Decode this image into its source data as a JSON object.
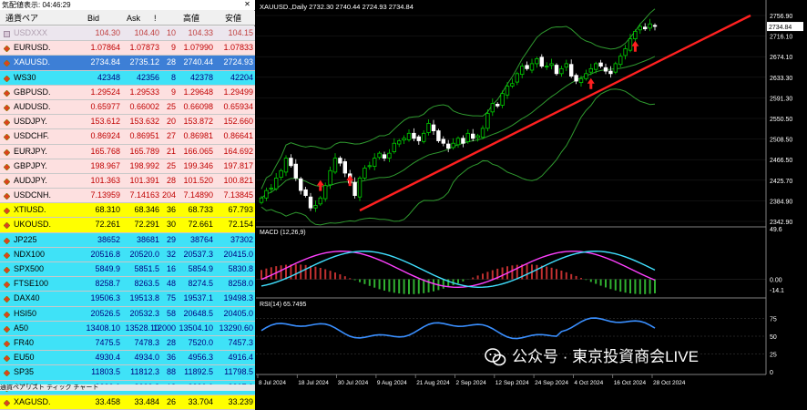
{
  "market_watch": {
    "title": "気配値表示: 04:46:29",
    "headers": {
      "symbol": "通貨ペア",
      "bid": "Bid",
      "ask": "Ask",
      "spread": "!",
      "high": "高値",
      "low": "安値"
    },
    "rows": [
      {
        "symbol": "USDXXX",
        "bid": "104.30",
        "ask": "104.40",
        "spread": "10",
        "high": "104.33",
        "low": "104.15",
        "bg": "#ece6ee",
        "fg": "#c04040",
        "disabled": true
      },
      {
        "symbol": "EURUSD.",
        "bid": "1.07864",
        "ask": "1.07873",
        "spread": "9",
        "high": "1.07990",
        "low": "1.07833",
        "bg": "#fde0e0",
        "fg": "#c00000"
      },
      {
        "symbol": "XAUUSD.",
        "bid": "2734.84",
        "ask": "2735.12",
        "spread": "28",
        "high": "2740.44",
        "low": "2724.93",
        "bg": "#3d7fd6",
        "fg": "#ffffff"
      },
      {
        "symbol": "WS30",
        "bid": "42348",
        "ask": "42356",
        "spread": "8",
        "high": "42378",
        "low": "42204",
        "bg": "#3fe2f7",
        "fg": "#000080"
      },
      {
        "symbol": "GBPUSD.",
        "bid": "1.29524",
        "ask": "1.29533",
        "spread": "9",
        "high": "1.29648",
        "low": "1.29499",
        "bg": "#fde0e0",
        "fg": "#c00000"
      },
      {
        "symbol": "AUDUSD.",
        "bid": "0.65977",
        "ask": "0.66002",
        "spread": "25",
        "high": "0.66098",
        "low": "0.65934",
        "bg": "#fde0e0",
        "fg": "#c00000"
      },
      {
        "symbol": "USDJPY.",
        "bid": "153.612",
        "ask": "153.632",
        "spread": "20",
        "high": "153.872",
        "low": "152.660",
        "bg": "#fde0e0",
        "fg": "#c00000"
      },
      {
        "symbol": "USDCHF.",
        "bid": "0.86924",
        "ask": "0.86951",
        "spread": "27",
        "high": "0.86981",
        "low": "0.86641",
        "bg": "#fde0e0",
        "fg": "#c00000"
      },
      {
        "symbol": "EURJPY.",
        "bid": "165.768",
        "ask": "165.789",
        "spread": "21",
        "high": "166.065",
        "low": "164.692",
        "bg": "#fde0e0",
        "fg": "#c00000"
      },
      {
        "symbol": "GBPJPY.",
        "bid": "198.967",
        "ask": "198.992",
        "spread": "25",
        "high": "199.346",
        "low": "197.817",
        "bg": "#fde0e0",
        "fg": "#c00000"
      },
      {
        "symbol": "AUDJPY.",
        "bid": "101.363",
        "ask": "101.391",
        "spread": "28",
        "high": "101.520",
        "low": "100.821",
        "bg": "#fde0e0",
        "fg": "#c00000"
      },
      {
        "symbol": "USDCNH.",
        "bid": "7.13959",
        "ask": "7.14163",
        "spread": "204",
        "high": "7.14890",
        "low": "7.13845",
        "bg": "#fde0e0",
        "fg": "#c00000"
      },
      {
        "symbol": "XTIUSD.",
        "bid": "68.310",
        "ask": "68.346",
        "spread": "36",
        "high": "68.733",
        "low": "67.793",
        "bg": "#ffff00",
        "fg": "#000000"
      },
      {
        "symbol": "UKOUSD.",
        "bid": "72.261",
        "ask": "72.291",
        "spread": "30",
        "high": "72.661",
        "low": "72.154",
        "bg": "#ffff00",
        "fg": "#000000"
      },
      {
        "symbol": "JP225",
        "bid": "38652",
        "ask": "38681",
        "spread": "29",
        "high": "38764",
        "low": "37302",
        "bg": "#3fe2f7",
        "fg": "#000080"
      },
      {
        "symbol": "NDX100",
        "bid": "20516.8",
        "ask": "20520.0",
        "spread": "32",
        "high": "20537.3",
        "low": "20415.0",
        "bg": "#3fe2f7",
        "fg": "#000080"
      },
      {
        "symbol": "SPX500",
        "bid": "5849.9",
        "ask": "5851.5",
        "spread": "16",
        "high": "5854.9",
        "low": "5830.8",
        "bg": "#3fe2f7",
        "fg": "#000080"
      },
      {
        "symbol": "FTSE100",
        "bid": "8258.7",
        "ask": "8263.5",
        "spread": "48",
        "high": "8274.5",
        "low": "8258.0",
        "bg": "#3fe2f7",
        "fg": "#000080"
      },
      {
        "symbol": "DAX40",
        "bid": "19506.3",
        "ask": "19513.8",
        "spread": "75",
        "high": "19537.1",
        "low": "19498.3",
        "bg": "#3fe2f7",
        "fg": "#000080"
      },
      {
        "symbol": "HSI50",
        "bid": "20526.5",
        "ask": "20532.3",
        "spread": "58",
        "high": "20648.5",
        "low": "20405.0",
        "bg": "#3fe2f7",
        "fg": "#000080"
      },
      {
        "symbol": "A50",
        "bid": "13408.10",
        "ask": "13528.10",
        "spread": "12000",
        "high": "13504.10",
        "low": "13290.60",
        "bg": "#3fe2f7",
        "fg": "#000080"
      },
      {
        "symbol": "FR40",
        "bid": "7475.5",
        "ask": "7478.3",
        "spread": "28",
        "high": "7520.0",
        "low": "7457.3",
        "bg": "#3fe2f7",
        "fg": "#000080"
      },
      {
        "symbol": "EU50",
        "bid": "4930.4",
        "ask": "4934.0",
        "spread": "36",
        "high": "4956.3",
        "low": "4916.4",
        "bg": "#3fe2f7",
        "fg": "#000080"
      },
      {
        "symbol": "SP35",
        "bid": "11803.5",
        "ask": "11812.3",
        "spread": "88",
        "high": "11892.5",
        "low": "11798.5",
        "bg": "#3fe2f7",
        "fg": "#000080"
      },
      {
        "symbol": "AU200",
        "bid": "8222.0",
        "ask": "8223.8",
        "spread": "18",
        "high": "8230.0",
        "low": "8207.0",
        "bg": "#3fe2f7",
        "fg": "#000080"
      },
      {
        "symbol": "XAGUSD.",
        "bid": "33.458",
        "ask": "33.484",
        "spread": "26",
        "high": "33.704",
        "low": "33.239",
        "bg": "#ffff00",
        "fg": "#000000"
      }
    ],
    "tabs": "通貨ペアリスト   ティック チャート"
  },
  "chart": {
    "header": "XAUUSD.,Daily  2732.30 2740.44 2724.93 2734.84",
    "price_labels": [
      "2756.90",
      "2716.10",
      "2674.10",
      "2633.30",
      "2591.30",
      "2550.50",
      "2508.50",
      "2466.50",
      "2425.70",
      "2384.90",
      "2342.90"
    ],
    "current_price_label": "2734.84",
    "dates": [
      "8 Jul 2024",
      "18 Jul 2024",
      "30 Jul 2024",
      "9 Aug 2024",
      "21 Aug 2024",
      "2 Sep 2024",
      "12 Sep 2024",
      "24 Sep 2024",
      "4 Oct 2024",
      "16 Oct 2024",
      "28 Oct 2024"
    ],
    "macd_label": "MACD (12,26,9)",
    "macd_scale": [
      "49.6",
      "0.00",
      "-14.1"
    ],
    "rsi_label": "RSI(14) 65.7495",
    "rsi_scale": [
      "75",
      "50",
      "25",
      "0"
    ],
    "colors": {
      "bull": "#00d200",
      "bear": "#ffffff",
      "trend": "#ff2020",
      "bands": "#2f9a2f",
      "macd_line": "#ff40ff",
      "signal": "#40e0ff",
      "rsi": "#3a8fff",
      "arrow": "#ff2020"
    }
  },
  "chart_data": [
    {
      "type": "candlestick",
      "title": "XAUUSD.,Daily",
      "xlabel": "",
      "ylabel": "",
      "ylim": [
        2342.9,
        2756.9
      ],
      "x_ticks": [
        "8 Jul 2024",
        "18 Jul 2024",
        "30 Jul 2024",
        "9 Aug 2024",
        "21 Aug 2024",
        "2 Sep 2024",
        "12 Sep 2024",
        "24 Sep 2024",
        "4 Oct 2024",
        "16 Oct 2024",
        "28 Oct 2024"
      ],
      "last": {
        "open": 2732.3,
        "high": 2740.44,
        "low": 2724.93,
        "close": 2734.84
      },
      "close_path": [
        2390,
        2405,
        2410,
        2430,
        2445,
        2470,
        2455,
        2430,
        2405,
        2395,
        2370,
        2375,
        2390,
        2415,
        2445,
        2470,
        2460,
        2440,
        2420,
        2395,
        2430,
        2450,
        2455,
        2470,
        2480,
        2470,
        2480,
        2500,
        2505,
        2510,
        2520,
        2510,
        2505,
        2520,
        2540,
        2525,
        2505,
        2500,
        2490,
        2500,
        2510,
        2500,
        2520,
        2510,
        2515,
        2530,
        2560,
        2580,
        2575,
        2600,
        2615,
        2620,
        2640,
        2655,
        2650,
        2660,
        2670,
        2655,
        2655,
        2660,
        2640,
        2650,
        2660,
        2635,
        2625,
        2630,
        2640,
        2650,
        2660,
        2655,
        2645,
        2640,
        2660,
        2675,
        2690,
        2710,
        2725,
        2735,
        2730,
        2740,
        2735
      ]
    },
    {
      "type": "line",
      "title": "MACD (12,26,9)",
      "ylim": [
        -14.1,
        49.6
      ]
    },
    {
      "type": "line",
      "title": "RSI(14) 65.7495",
      "ylim": [
        0,
        100
      ],
      "value": 65.7495
    }
  ],
  "watermark": "公众号 · 東京投資商会LIVE"
}
